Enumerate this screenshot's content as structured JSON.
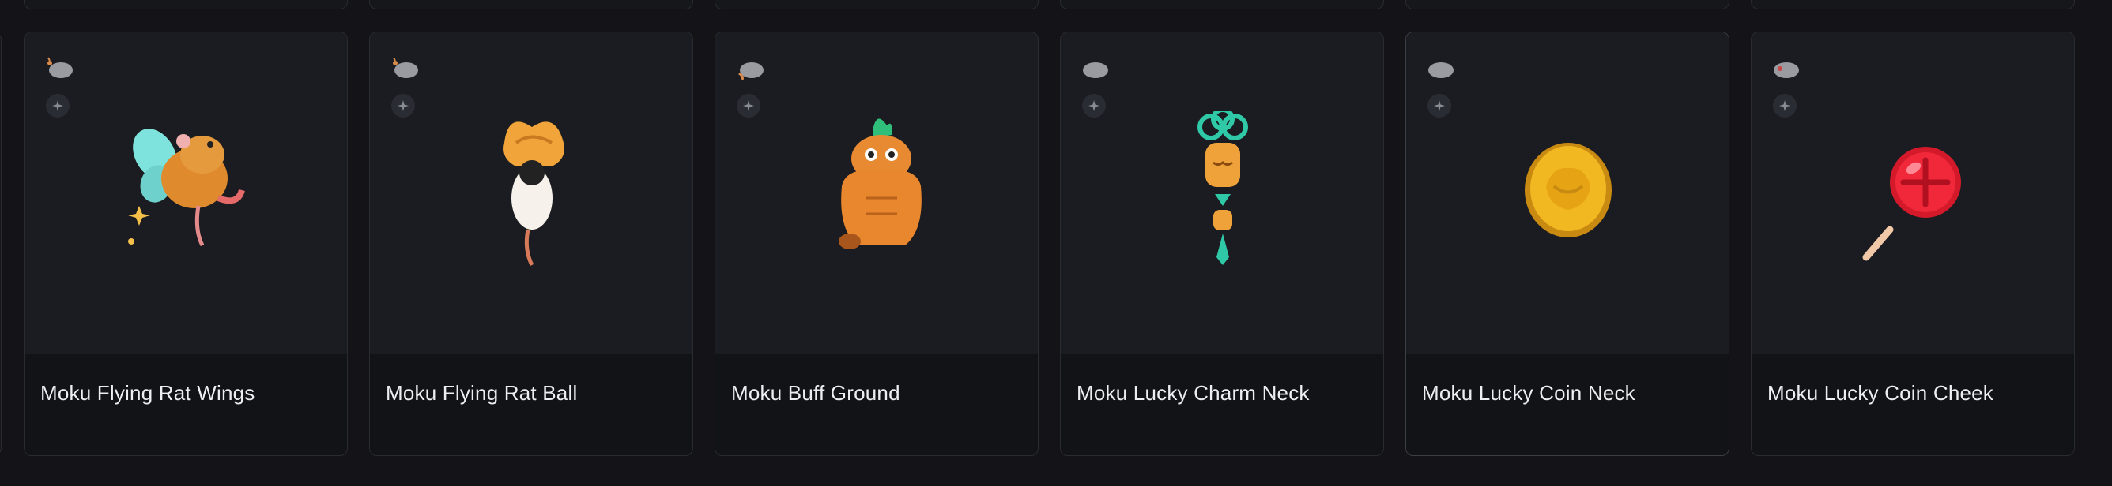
{
  "colors": {
    "background": "#141418",
    "card": "#1a1b20",
    "card_footer": "#121317",
    "title_text": "#eeeef2"
  },
  "cards": [
    {
      "title": "Moku Flying Rat Wings",
      "icon": "flying-rat-wings-art"
    },
    {
      "title": "Moku Flying Rat Ball",
      "icon": "flying-rat-ball-art"
    },
    {
      "title": "Moku Buff Ground",
      "icon": "buff-tanuki-art"
    },
    {
      "title": "Moku Lucky Charm Neck",
      "icon": "lucky-charm-art"
    },
    {
      "title": "Moku Lucky Coin Neck",
      "icon": "gold-coin-art"
    },
    {
      "title": "Moku Lucky Coin Cheek",
      "icon": "red-lollipop-coin-art"
    }
  ]
}
